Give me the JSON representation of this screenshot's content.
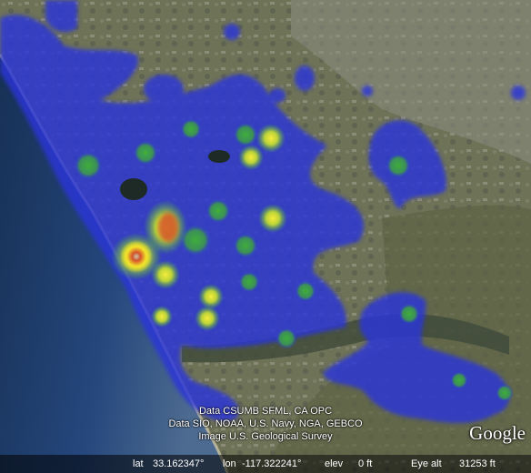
{
  "attribution": {
    "line1": "Data CSUMB SFML, CA OPC",
    "line2": "Data SIO, NOAA, U.S. Navy, NGA, GEBCO",
    "line3": "Image U.S. Geological Survey"
  },
  "logo": "Google",
  "status": {
    "lat_label": "lat",
    "lat_value": "33.162347°",
    "lon_label": "lon",
    "lon_value": "-117.322241°",
    "elev_label": "elev",
    "elev_value": "0 ft",
    "eye_label": "Eye alt",
    "eye_value": "31253 ft"
  },
  "colors": {
    "ocean_deep": "#1d3a68",
    "land": "#6f7357",
    "heat_low": "#2a35d8",
    "heat_mid": "#3fae3a",
    "heat_high": "#f3e22b",
    "heat_peak": "#d3522b"
  },
  "icons": [
    "google-logo"
  ]
}
